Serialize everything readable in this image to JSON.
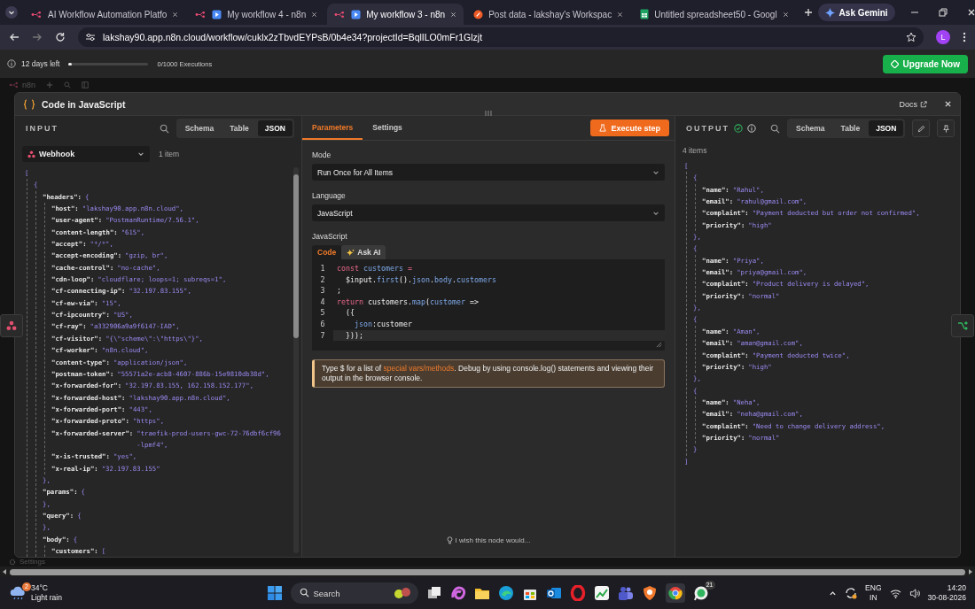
{
  "browser": {
    "tabs": [
      {
        "title": "AI Workflow Automation Platfo",
        "kind": "workflow",
        "selected": false
      },
      {
        "title": "My workflow 4 - n8n",
        "kind": "workflow-play",
        "selected": false
      },
      {
        "title": "My workflow 3 - n8n",
        "kind": "workflow-play",
        "selected": true
      },
      {
        "title": "Post data - lakshay's Workspac",
        "kind": "orb",
        "selected": false
      },
      {
        "title": "Untitled spreadsheet50 - Googl",
        "kind": "sheet",
        "selected": false
      }
    ],
    "assistant_button": "Ask Gemini",
    "url": "lakshay90.app.n8n.cloud/workflow/cuklx2zTbvdEYPsB/0b4e34?projectId=BqlILO0mFr1Glzjt",
    "avatar": "L"
  },
  "trial": {
    "days_left": "12 days left",
    "level": 0.04,
    "executions": "0/1000 Executions",
    "upgrade": "Upgrade Now"
  },
  "canvas": {
    "logo_text": "n8n",
    "settings": "Settings"
  },
  "modal": {
    "title": "Code in JavaScript",
    "docs": "Docs",
    "input": {
      "title": "INPUT",
      "views": [
        {
          "label": "Schema",
          "selected": false
        },
        {
          "label": "Table",
          "selected": false
        },
        {
          "label": "JSON",
          "selected": true
        }
      ],
      "source": "Webhook",
      "count": "1 item",
      "json": [
        {
          "value": "[",
          "children": [
            {
              "value": "{",
              "children": [
                {
                  "key": "\"headers\":",
                  "value": "{",
                  "children": [
                    {
                      "key": "\"host\":",
                      "value": "\"lakshay90.app.n8n.cloud\","
                    },
                    {
                      "key": "\"user-agent\":",
                      "value": "\"PostmanRuntime/7.56.1\","
                    },
                    {
                      "key": "\"content-length\":",
                      "value": "\"615\","
                    },
                    {
                      "key": "\"accept\":",
                      "value": "\"*/*\","
                    },
                    {
                      "key": "\"accept-encoding\":",
                      "value": "\"gzip, br\","
                    },
                    {
                      "key": "\"cache-control\":",
                      "value": "\"no-cache\","
                    },
                    {
                      "key": "\"cdn-loop\":",
                      "value": "\"cloudflare; loops=1; subreqs=1\","
                    },
                    {
                      "key": "\"cf-connecting-ip\":",
                      "value": "\"32.197.83.155\","
                    },
                    {
                      "key": "\"cf-ew-via\":",
                      "value": "\"15\","
                    },
                    {
                      "key": "\"cf-ipcountry\":",
                      "value": "\"US\","
                    },
                    {
                      "key": "\"cf-ray\":",
                      "value": "\"a332906a9a9f6147-IAD\","
                    },
                    {
                      "key": "\"cf-visitor\":",
                      "value": "\"{\\\"scheme\\\":\\\"https\\\"}\","
                    },
                    {
                      "key": "\"cf-worker\":",
                      "value": "\"n8n.cloud\","
                    },
                    {
                      "key": "\"content-type\":",
                      "value": "\"application/json\","
                    },
                    {
                      "key": "\"postman-token\":",
                      "value": "\"55571a2e-acb8-4607-886b-15e9810db38d\","
                    },
                    {
                      "key": "\"x-forwarded-for\":",
                      "value": "\"32.197.83.155, 162.158.152.177\","
                    },
                    {
                      "key": "\"x-forwarded-host\":",
                      "value": "\"lakshay90.app.n8n.cloud\","
                    },
                    {
                      "key": "\"x-forwarded-port\":",
                      "value": "\"443\","
                    },
                    {
                      "key": "\"x-forwarded-proto\":",
                      "value": "\"https\","
                    },
                    {
                      "key": "\"x-forwarded-server\":",
                      "value": "\"traefik-prod-users-gwc-72-76dbf6cf96-lpmf4\","
                    },
                    {
                      "key": "\"x-is-trusted\":",
                      "value": "\"yes\","
                    },
                    {
                      "key": "\"x-real-ip\":",
                      "value": "\"32.197.83.155\""
                    }
                  ]
                },
                {
                  "value": "},"
                },
                {
                  "key": "\"params\":",
                  "value": "{"
                },
                {
                  "value": "},"
                },
                {
                  "key": "\"query\":",
                  "value": "{"
                },
                {
                  "value": "},"
                },
                {
                  "key": "\"body\":",
                  "value": "{",
                  "children": [
                    {
                      "key": "\"customers\":",
                      "value": "["
                    }
                  ]
                }
              ]
            }
          ]
        }
      ]
    },
    "parameters": {
      "tabs": [
        {
          "label": "Parameters",
          "selected": true
        },
        {
          "label": "Settings",
          "selected": false
        }
      ],
      "execute": "Execute step",
      "fields": [
        {
          "label": "Mode",
          "value": "Run Once for All Items"
        },
        {
          "label": "Language",
          "value": "JavaScript"
        }
      ],
      "editor": {
        "label": "JavaScript",
        "tabs": [
          {
            "label": "Code",
            "kind": "plain",
            "selected": true
          },
          {
            "label": "Ask AI",
            "kind": "ai",
            "selected": false
          }
        ],
        "lines": [
          {
            "number": "1",
            "active": false,
            "tokens": [
              {
                "text": "const ",
                "kind": "keyword"
              },
              {
                "text": "customers",
                "kind": "name"
              },
              {
                "text": " =",
                "kind": "keyword"
              }
            ]
          },
          {
            "number": "2",
            "active": false,
            "tokens": [
              {
                "text": "  $input.",
                "kind": "plain"
              },
              {
                "text": "first",
                "kind": "call"
              },
              {
                "text": "().",
                "kind": "plain"
              },
              {
                "text": "json",
                "kind": "name"
              },
              {
                "text": ".",
                "kind": "plain"
              },
              {
                "text": "body",
                "kind": "name"
              },
              {
                "text": ".",
                "kind": "plain"
              },
              {
                "text": "customers",
                "kind": "name"
              }
            ]
          },
          {
            "number": "3",
            "active": false,
            "tokens": [
              {
                "text": ";",
                "kind": "plain"
              }
            ]
          },
          {
            "number": "4",
            "active": false,
            "tokens": [
              {
                "text": "return ",
                "kind": "keyword"
              },
              {
                "text": "customers.",
                "kind": "plain"
              },
              {
                "text": "map",
                "kind": "call"
              },
              {
                "text": "(",
                "kind": "plain"
              },
              {
                "text": "customer",
                "kind": "name"
              },
              {
                "text": " =>",
                "kind": "plain"
              }
            ]
          },
          {
            "number": "5",
            "active": false,
            "tokens": [
              {
                "text": "  ({",
                "kind": "plain"
              }
            ]
          },
          {
            "number": "6",
            "active": false,
            "tokens": [
              {
                "text": "    json",
                "kind": "name"
              },
              {
                "text": ":customer",
                "kind": "plain"
              }
            ]
          },
          {
            "number": "7",
            "active": true,
            "tokens": [
              {
                "text": "  }));",
                "kind": "plain"
              }
            ]
          }
        ]
      },
      "hint": {
        "before": "Type $ for a list of ",
        "link": "special vars/methods",
        "after": ". Debug by using console.log() statements and viewing their output in the browser console."
      },
      "feedback": "I wish this node would..."
    },
    "output": {
      "title": "OUTPUT",
      "views": [
        {
          "label": "Schema",
          "selected": false
        },
        {
          "label": "Table",
          "selected": false
        },
        {
          "label": "JSON",
          "selected": true
        }
      ],
      "count": "4 items",
      "json": [
        {
          "value": "[",
          "children": [
            {
              "value": "{",
              "children": [
                {
                  "key": "\"name\":",
                  "value": "\"Rahul\","
                },
                {
                  "key": "\"email\":",
                  "value": "\"rahul@gmail.com\","
                },
                {
                  "key": "\"complaint\":",
                  "value": "\"Payment deducted but order not confirmed\","
                },
                {
                  "key": "\"priority\":",
                  "value": "\"high\""
                }
              ]
            },
            {
              "value": "},"
            },
            {
              "value": "{",
              "children": [
                {
                  "key": "\"name\":",
                  "value": "\"Priya\","
                },
                {
                  "key": "\"email\":",
                  "value": "\"priya@gmail.com\","
                },
                {
                  "key": "\"complaint\":",
                  "value": "\"Product delivery is delayed\","
                },
                {
                  "key": "\"priority\":",
                  "value": "\"normal\""
                }
              ]
            },
            {
              "value": "},"
            },
            {
              "value": "{",
              "children": [
                {
                  "key": "\"name\":",
                  "value": "\"Aman\","
                },
                {
                  "key": "\"email\":",
                  "value": "\"aman@gmail.com\","
                },
                {
                  "key": "\"complaint\":",
                  "value": "\"Payment deducted twice\","
                },
                {
                  "key": "\"priority\":",
                  "value": "\"high\""
                }
              ]
            },
            {
              "value": "},"
            },
            {
              "value": "{",
              "children": [
                {
                  "key": "\"name\":",
                  "value": "\"Neha\","
                },
                {
                  "key": "\"email\":",
                  "value": "\"neha@gmail.com\","
                },
                {
                  "key": "\"complaint\":",
                  "value": "\"Need to change delivery address\","
                },
                {
                  "key": "\"priority\":",
                  "value": "\"normal\""
                }
              ]
            },
            {
              "value": "}"
            }
          ]
        },
        {
          "value": "]"
        }
      ]
    }
  },
  "taskbar": {
    "temperature": "34°C",
    "weather": "Light rain",
    "weather_badge": "2",
    "search_placeholder": "Search",
    "chat_badge": "21",
    "language": "ENG",
    "region": "IN",
    "time": "14:20",
    "date": "30-08-2026"
  }
}
